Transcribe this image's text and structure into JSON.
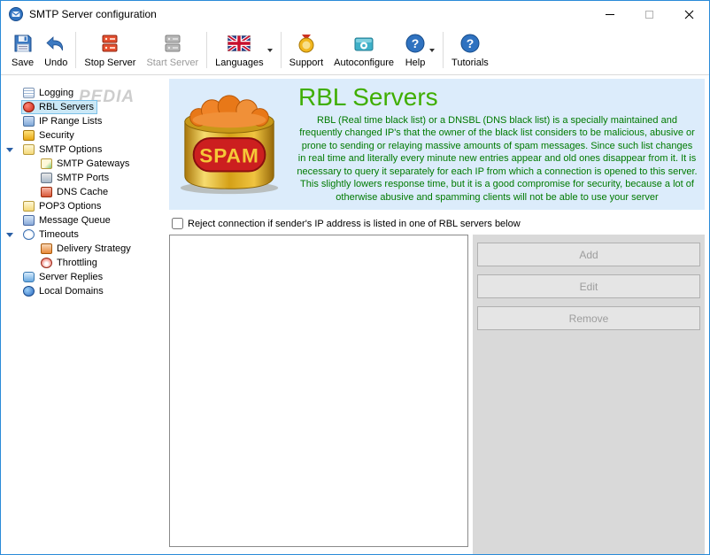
{
  "window": {
    "title": "SMTP Server configuration"
  },
  "toolbar": {
    "items": [
      {
        "label": "Save",
        "disabled": false
      },
      {
        "label": "Undo",
        "disabled": false
      },
      {
        "label": "Stop Server",
        "disabled": false
      },
      {
        "label": "Start Server",
        "disabled": true
      },
      {
        "label": "Languages",
        "dropdown": true
      },
      {
        "label": "Support"
      },
      {
        "label": "Autoconfigure"
      },
      {
        "label": "Help",
        "dropdown": true
      },
      {
        "label": "Tutorials"
      }
    ]
  },
  "icons": {
    "help_glyph": "?"
  },
  "sidebar": {
    "items": [
      {
        "label": "Logging"
      },
      {
        "label": "RBL Servers",
        "selected": true
      },
      {
        "label": "IP Range Lists"
      },
      {
        "label": "Security"
      },
      {
        "label": "SMTP Options",
        "expanded": true
      },
      {
        "label": "SMTP Gateways",
        "child": true
      },
      {
        "label": "SMTP Ports",
        "child": true
      },
      {
        "label": "DNS Cache",
        "child": true
      },
      {
        "label": "POP3 Options"
      },
      {
        "label": "Message Queue"
      },
      {
        "label": "Timeouts",
        "expanded": true
      },
      {
        "label": "Delivery Strategy",
        "child": true
      },
      {
        "label": "Throttling",
        "child": true
      },
      {
        "label": "Server Replies"
      },
      {
        "label": "Local Domains"
      }
    ]
  },
  "main": {
    "header": {
      "title": "RBL Servers",
      "spam_label": "SPAM",
      "description": "RBL (Real time black list) or a DNSBL (DNS black list) is a specially maintained and frequently changed IP's that the owner of the black list considers to be malicious, abusive or prone to sending or relaying massive amounts of spam messages. Since such list changes in real time and literally every minute new entries appear and old ones disappear from it. It is necessary to query it separately for each IP from which a connection is opened to this server. This slightly lowers response time, but it is a good compromise for security, because a lot of otherwise abusive and spamming clients will not be able to use your server"
    },
    "checkbox": {
      "label": "Reject connection if sender's IP address is listed in one of RBL servers below",
      "checked": false
    },
    "rbl_list": {
      "items": []
    },
    "buttons": [
      {
        "label": "Add",
        "disabled": true
      },
      {
        "label": "Edit",
        "disabled": true
      },
      {
        "label": "Remove",
        "disabled": true
      }
    ]
  },
  "watermark": "PEDIA",
  "colors": {
    "accent_green": "#3fae00",
    "text_green": "#007a00",
    "header_bg": "#dcecfb",
    "selection_bg": "#cbe8f6",
    "panel_gray": "#d9d9d9"
  }
}
